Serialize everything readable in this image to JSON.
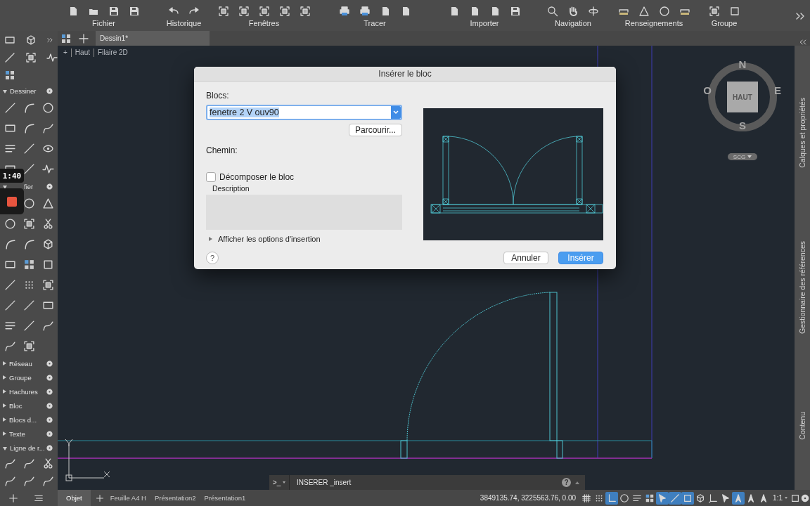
{
  "ribbon": {
    "groups": [
      {
        "label": "Fichier"
      },
      {
        "label": "Historique"
      },
      {
        "label": "Fenêtres"
      },
      {
        "label": "Tracer"
      },
      {
        "label": "Importer"
      },
      {
        "label": "Navigation"
      },
      {
        "label": "Renseignements"
      },
      {
        "label": "Groupe"
      }
    ]
  },
  "palette": {
    "sections": [
      {
        "label": "Dessiner",
        "expanded": true
      },
      {
        "label": "fier",
        "expanded": true
      },
      {
        "label": "Réseau",
        "expanded": false
      },
      {
        "label": "Groupe",
        "expanded": false
      },
      {
        "label": "Hachures",
        "expanded": false
      },
      {
        "label": "Bloc",
        "expanded": false
      },
      {
        "label": "Blocs d...",
        "expanded": false
      },
      {
        "label": "Texte",
        "expanded": false
      },
      {
        "label": "Ligne de r...",
        "expanded": true
      }
    ]
  },
  "recording": {
    "time": "1:40"
  },
  "document_tabs": [
    {
      "label": "Dessin1*",
      "selected": true
    }
  ],
  "viewport_label": {
    "items": [
      "+",
      "Haut",
      "Filaire 2D"
    ]
  },
  "view_cube": {
    "face": "HAUT",
    "north": "N",
    "south": "S",
    "east": "E",
    "west": "O",
    "ucs_menu": "SCG"
  },
  "side_panels": [
    {
      "label": "Calques et propriétés"
    },
    {
      "label": "Gestionnaire des références"
    },
    {
      "label": "Contenu"
    }
  ],
  "dialog": {
    "title": "Insérer le bloc",
    "blocks_label": "Blocs:",
    "block_value": "fenetre 2 V ouv90",
    "browse_button": "Parcourir...",
    "path_label": "Chemin:",
    "explode": {
      "label": "Décomposer le bloc",
      "checked": false
    },
    "description_label": "Description",
    "options": {
      "label": "Afficher les options d'insertion",
      "expanded": false
    },
    "help": "?",
    "buttons": [
      {
        "label": "Annuler",
        "default": false
      },
      {
        "label": "Insérer",
        "default": true
      }
    ]
  },
  "command_line": {
    "prompt": ">_",
    "text": "INSERER _insert",
    "help": "?"
  },
  "layout_tabs": [
    {
      "label": "Objet",
      "selected": true
    },
    {
      "label": "Feuille A4 H",
      "selected": false
    },
    {
      "label": "Présentation2",
      "selected": false
    },
    {
      "label": "Présentation1",
      "selected": false
    }
  ],
  "status_bar": {
    "coordinates": "3849135.74, 3225563.76, 0.00",
    "toggles": [
      {
        "on": false
      },
      {
        "on": false
      },
      {
        "on": true
      },
      {
        "on": false
      },
      {
        "on": false
      },
      {
        "on": false
      },
      {
        "on": true
      },
      {
        "on": true
      },
      {
        "on": true
      },
      {
        "on": false
      },
      {
        "on": false
      },
      {
        "on": false
      },
      {
        "on": true
      },
      {
        "on": false
      },
      {
        "on": false
      }
    ],
    "scale": "1:1"
  }
}
